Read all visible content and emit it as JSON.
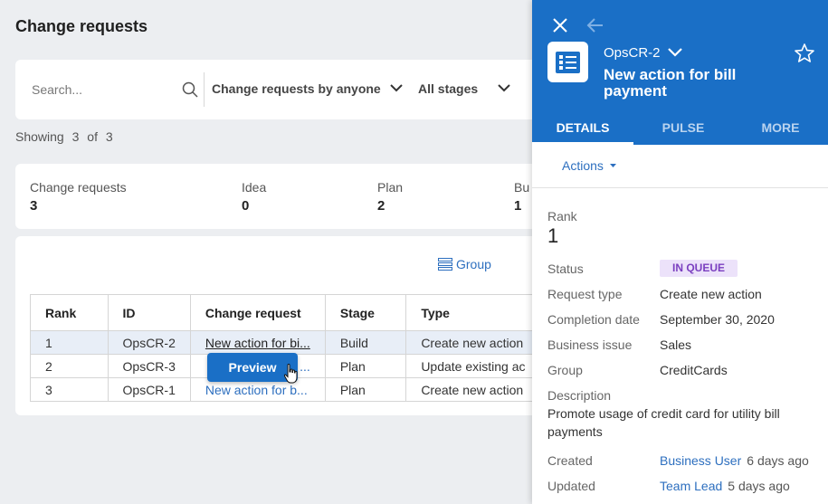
{
  "page": {
    "title": "Change requests"
  },
  "search": {
    "placeholder": "Search...",
    "filter_owner": "Change requests by anyone",
    "filter_stage": "All stages"
  },
  "showing": {
    "prefix": "Showing",
    "count": "3",
    "of": "of",
    "total": "3"
  },
  "stats": [
    {
      "label": "Change requests",
      "value": "3"
    },
    {
      "label": "Idea",
      "value": "0"
    },
    {
      "label": "Plan",
      "value": "2"
    },
    {
      "label": "Bu",
      "value": "1"
    }
  ],
  "table": {
    "group_label": "Group",
    "columns": [
      "Rank",
      "ID",
      "Change request",
      "Stage",
      "Type"
    ],
    "rows": [
      {
        "rank": "1",
        "id": "OpsCR-2",
        "request": "New action for bi...",
        "stage": "Build",
        "type": "Create new action"
      },
      {
        "rank": "2",
        "id": "OpsCR-3",
        "request": "s ...",
        "stage": "Plan",
        "type": "Update existing ac"
      },
      {
        "rank": "3",
        "id": "OpsCR-1",
        "request": "New action for b...",
        "stage": "Plan",
        "type": "Create new action"
      }
    ],
    "preview_label": "Preview"
  },
  "panel": {
    "case_id": "OpsCR-2",
    "title": "New action for bill payment",
    "tabs": [
      "DETAILS",
      "PULSE",
      "MORE"
    ],
    "actions_label": "Actions",
    "fields": {
      "rank_label": "Rank",
      "rank_value": "1",
      "status_label": "Status",
      "status_value": "IN QUEUE",
      "request_type_label": "Request type",
      "request_type_value": "Create new action",
      "completion_label": "Completion date",
      "completion_value": "September 30, 2020",
      "issue_label": "Business issue",
      "issue_value": "Sales",
      "group_label": "Group",
      "group_value": "CreditCards",
      "description_label": "Description",
      "description_value": "Promote usage of credit card for utility bill payments",
      "created_label": "Created",
      "created_by": "Business User",
      "created_when": "6 days ago",
      "updated_label": "Updated",
      "updated_by": "Team Lead",
      "updated_when": "5 days ago"
    }
  },
  "colors": {
    "brand_blue": "#1a6fc6",
    "link_blue": "#2d6fbf",
    "badge_purple": "#7b3fc0",
    "badge_bg": "#ece2fa"
  },
  "icons": [
    "search-icon",
    "chevron-down-icon",
    "group-icon",
    "hand-cursor-icon",
    "close-icon",
    "back-arrow-icon",
    "case-type-icon",
    "star-icon",
    "caret-down-icon"
  ]
}
